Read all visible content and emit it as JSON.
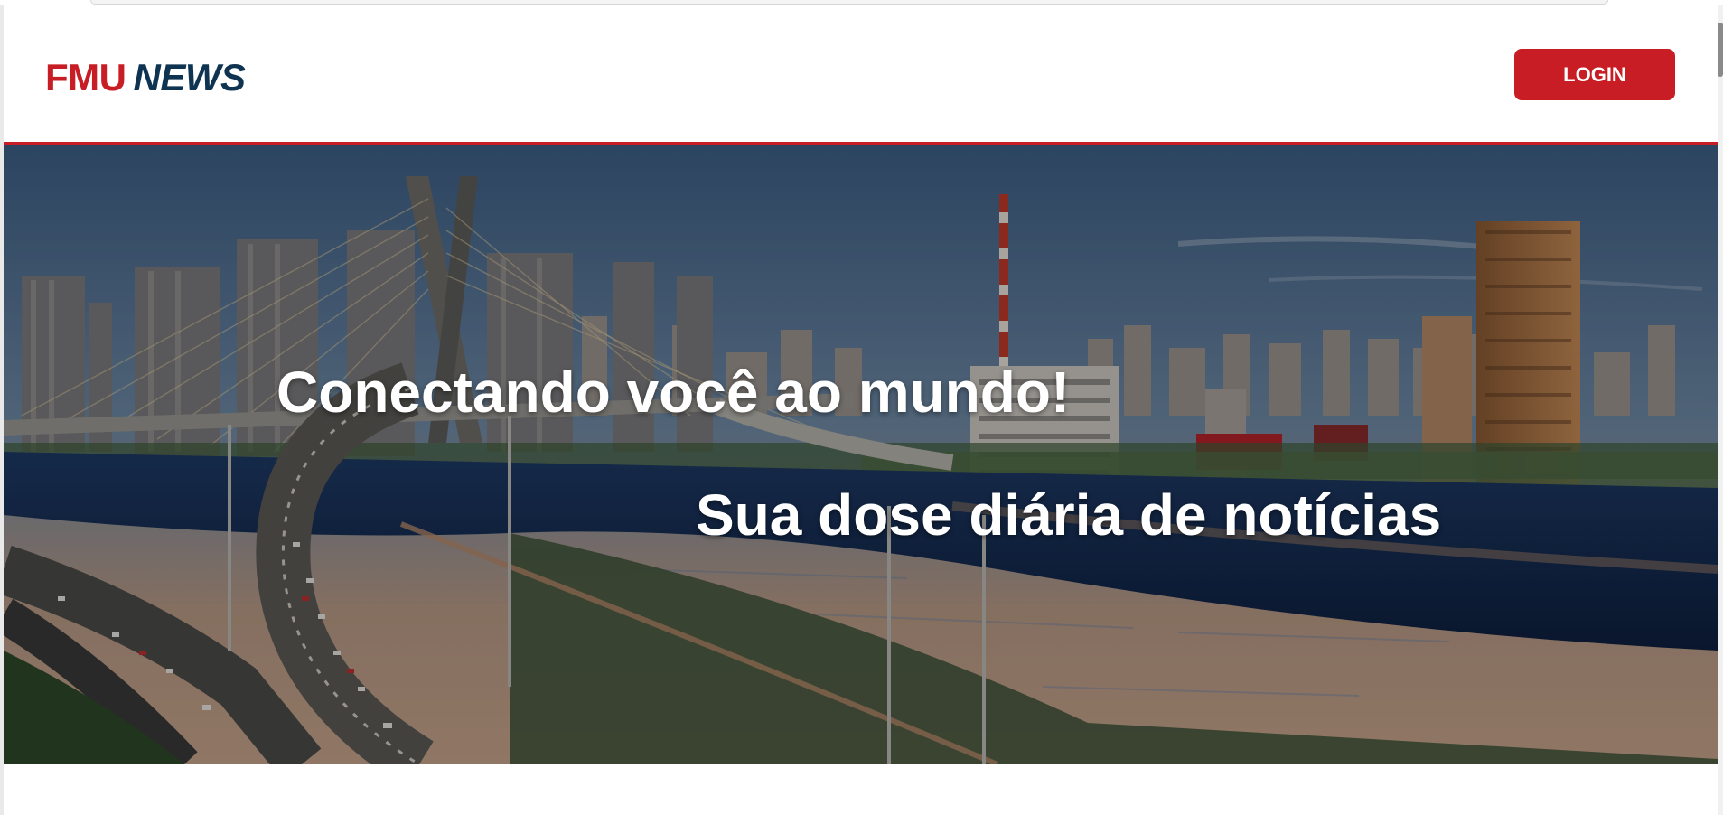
{
  "header": {
    "logo_brand": "FMU",
    "logo_suffix": "NEWS",
    "login_label": "LOGIN"
  },
  "hero": {
    "headline": "Conectando você ao mundo!",
    "subheadline": "Sua dose diária de notícias",
    "image_description_icon": "city-skyline-photo"
  },
  "colors": {
    "brand_red": "#c81d25",
    "brand_navy": "#0f3452",
    "header_bg": "#ffffff",
    "headline_text": "#ffffff"
  }
}
